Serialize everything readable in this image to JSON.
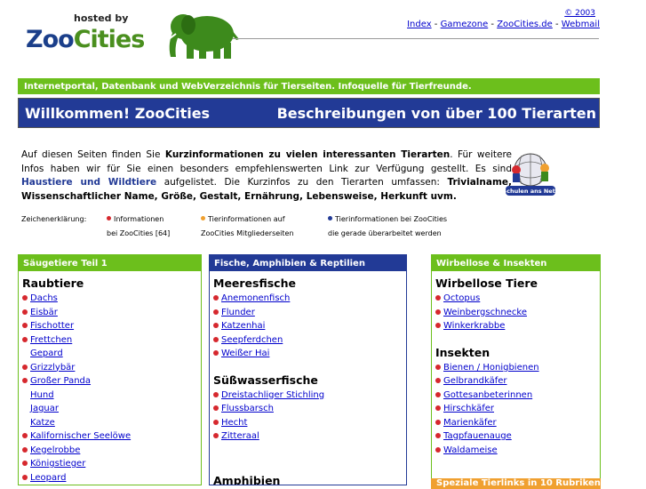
{
  "header": {
    "logo": {
      "hosted_by": "hosted by",
      "zoo": "Zoo",
      "cities": "Cities"
    },
    "copyright": "© 2003",
    "nav": [
      {
        "label": "Index"
      },
      {
        "label": "Gamezone"
      },
      {
        "label": "ZooCities.de"
      },
      {
        "label": "Webmail"
      }
    ],
    "nav_separator": " - "
  },
  "tagline": "Internetportal, Datenbank und WebVerzeichnis für Tierseiten. Infoquelle für Tierfreunde.",
  "banner": {
    "welcome": "Willkommen! ZooCities",
    "description": "Beschreibungen von über 100 Tierarten"
  },
  "intro": {
    "p1": "Auf diesen Seiten finden Sie ",
    "b1": "Kurzinformationen zu vielen interessanten Tierarten",
    "p2": ". Für weitere Infos haben wir für Sie einen besonders empfehlenswerten Link zur Verfügung gestellt. Es sind ",
    "b2": "Haustiere und Wildtiere",
    "p3": " aufgelistet. Die Kurzinfos zu den Tierarten umfassen: ",
    "b3": "Trivialname, Wissenschaftlicher Name, Größe, Gestalt, Ernährung, Lebensweise, Herkunft uvm.",
    "badge_text": "Schulen ans Netz"
  },
  "legend": {
    "label": "Zeichenerklärung:",
    "items": [
      {
        "line1": "Informationen",
        "line2": "bei ZooCities [64]",
        "color": "#d6282e"
      },
      {
        "line1": "Tierinformationen auf",
        "line2": "ZooCities Mitgliederseiten",
        "color": "#f0a030"
      },
      {
        "line1": "Tierinformationen bei ZooCities",
        "line2": "die gerade überarbeitet werden",
        "color": "#223a96"
      }
    ]
  },
  "columns": {
    "col1": {
      "title": "Säugetiere Teil 1",
      "section": "Raubtiere",
      "items": [
        {
          "label": "Dachs",
          "bullet": true
        },
        {
          "label": "Eisbär",
          "bullet": true
        },
        {
          "label": "Fischotter",
          "bullet": true
        },
        {
          "label": "Frettchen",
          "bullet": true
        },
        {
          "label": "Gepard",
          "bullet": false
        },
        {
          "label": "Grizzlybär",
          "bullet": true
        },
        {
          "label": "Großer Panda",
          "bullet": true
        },
        {
          "label": "Hund",
          "bullet": false
        },
        {
          "label": "Jaguar",
          "bullet": false
        },
        {
          "label": "Katze",
          "bullet": false
        },
        {
          "label": "Kalifornischer Seelöwe",
          "bullet": true
        },
        {
          "label": "Kegelrobbe",
          "bullet": true
        },
        {
          "label": "Königstieger",
          "bullet": true
        },
        {
          "label": "Leopard",
          "bullet": true
        }
      ]
    },
    "col2": {
      "title": "Fische, Amphibien & Reptilien",
      "sections": [
        {
          "name": "Meeresfische",
          "items": [
            "Anemonenfisch",
            "Flunder",
            "Katzenhai",
            "Seepferdchen",
            "Weißer Hai"
          ]
        },
        {
          "name": "Süßwasserfische",
          "items": [
            "Dreistachliger Stichling",
            "Flussbarsch",
            "Hecht",
            "Zitteraal"
          ]
        },
        {
          "name": "Amphibien",
          "items": []
        }
      ]
    },
    "col3": {
      "title": "Wirbellose & Insekten",
      "sections": [
        {
          "name": "Wirbellose Tiere",
          "items": [
            "Octopus",
            "Weinbergschnecke",
            "Winkerkrabbe"
          ]
        },
        {
          "name": "Insekten",
          "items": [
            "Bienen / Honigbienen",
            "Gelbrandkäfer",
            "Gottesanbeterinnen",
            "Hirschkäfer",
            "Marienkäfer",
            "Tagpfauenauge",
            "Waldameise"
          ]
        }
      ]
    }
  },
  "bottom_bar_partial": "Speziale Tierlinks in 10 Rubriken"
}
